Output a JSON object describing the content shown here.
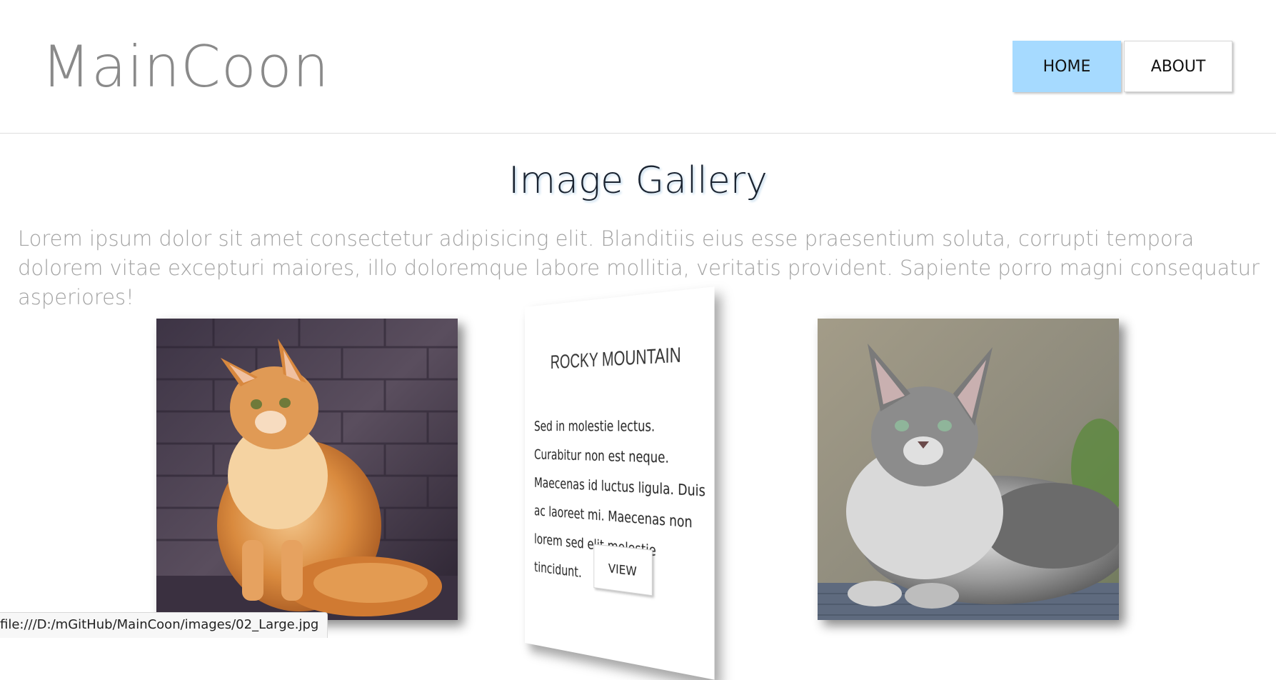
{
  "header": {
    "logo": "MainCoon",
    "nav": [
      {
        "label": "HOME",
        "active": true
      },
      {
        "label": "ABOUT",
        "active": false
      }
    ]
  },
  "main": {
    "title": "Image Gallery",
    "intro": "Lorem ipsum dolor sit amet consectetur adipisicing elit. Blanditiis eius esse praesentium soluta, corrupti tempora dolorem vitae excepturi maiores, illo doloremque labore mollitia, veritatis provident. Sapiente porro magni consequatur asperiores!",
    "gallery": [
      {
        "type": "image",
        "alt": "orange maine coon cat photo"
      },
      {
        "type": "card",
        "title": "ROCKY MOUNTAIN",
        "text": "Sed in molestie lectus. Curabitur non est neque. Maecenas id luctus ligula. Duis ac laoreet mi. Maecenas non lorem sed elit molestie tincidunt.",
        "button": "VIEW"
      },
      {
        "type": "image",
        "alt": "grey maine coon cat photo"
      }
    ]
  },
  "status_bar": {
    "url": "file:///D:/mGitHub/MainCoon/images/02_Large.jpg"
  },
  "colors": {
    "nav_active": "#a6daff",
    "logo": "#8a8a8a",
    "intro_text": "#a2a2a2"
  }
}
